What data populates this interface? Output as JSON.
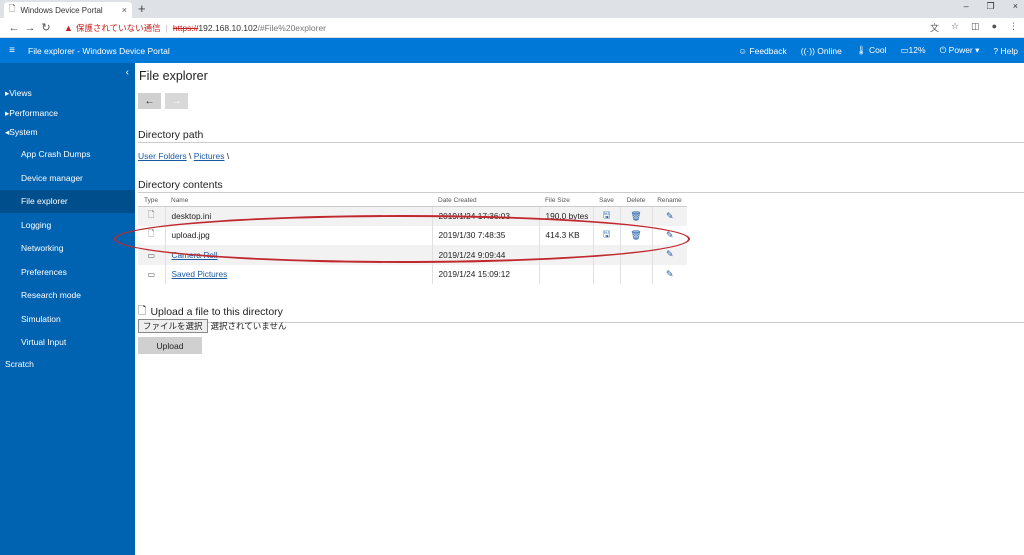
{
  "browser": {
    "tab_title": "Windows Device Portal",
    "tab_close": "×",
    "new_tab": "+",
    "window_controls": [
      "–",
      "❐",
      "×"
    ],
    "url_warning": "保護されていない通信",
    "url_protocol": "https://",
    "url_host": "192.168.10.102",
    "url_path": "/#File%20explorer"
  },
  "header": {
    "title": "File explorer - Windows Device Portal",
    "actions": [
      {
        "icon": "smiley-icon",
        "glyph": "☺",
        "label": "Feedback"
      },
      {
        "icon": "signal-icon",
        "glyph": "((·))",
        "label": "Online"
      },
      {
        "icon": "thermometer-icon",
        "glyph": "🌡",
        "label": "Cool"
      },
      {
        "icon": "battery-icon",
        "glyph": "▭",
        "label": "12%"
      },
      {
        "icon": "power-icon",
        "glyph": "⏻",
        "label": "Power ▾"
      },
      {
        "icon": "help-icon",
        "glyph": "?",
        "label": "Help"
      }
    ]
  },
  "sidebar": {
    "collapse_glyph": "‹",
    "groups": [
      {
        "label": "▸Views"
      },
      {
        "label": "▸Performance"
      },
      {
        "label": "◂System"
      }
    ],
    "items": [
      "App Crash Dumps",
      "Device manager",
      "File explorer",
      "Logging",
      "Networking",
      "Preferences",
      "Research mode",
      "Simulation",
      "Virtual Input"
    ],
    "active_index": 2,
    "scratch": "Scratch"
  },
  "content": {
    "title": "File explorer",
    "back_glyph": "←",
    "forward_glyph": "→",
    "directory_path_title": "Directory path",
    "breadcrumb": {
      "part1": "User Folders",
      "sep1": " \\ ",
      "part2": "Pictures",
      "sep2": " \\"
    },
    "directory_contents_title": "Directory contents",
    "columns": [
      "Type",
      "Name",
      "Date Created",
      "File Size",
      "Save",
      "Delete",
      "Rename"
    ],
    "rows": [
      {
        "type": "file",
        "name": "desktop.ini",
        "date": "2019/1/24 17:36:03",
        "size": "190.0 bytes",
        "link": false,
        "saveable": true
      },
      {
        "type": "file",
        "name": "upload.jpg",
        "date": "2019/1/30 7:48:35",
        "size": "414.3 KB",
        "link": false,
        "saveable": true
      },
      {
        "type": "folder",
        "name": "Camera Roll",
        "date": "2019/1/24 9:09:44",
        "size": "",
        "link": true,
        "saveable": false
      },
      {
        "type": "folder",
        "name": "Saved Pictures",
        "date": "2019/1/24 15:09:12",
        "size": "",
        "link": true,
        "saveable": false
      }
    ],
    "upload_title": "Upload a file to this directory",
    "choose_file_label": "ファイルを選択",
    "no_file_label": "選択されていません",
    "upload_button": "Upload"
  },
  "colors": {
    "header": "#0078d7",
    "sidebar": "#0063b1",
    "sidebar_active": "#004e8c",
    "annotation": "#c0282e"
  }
}
